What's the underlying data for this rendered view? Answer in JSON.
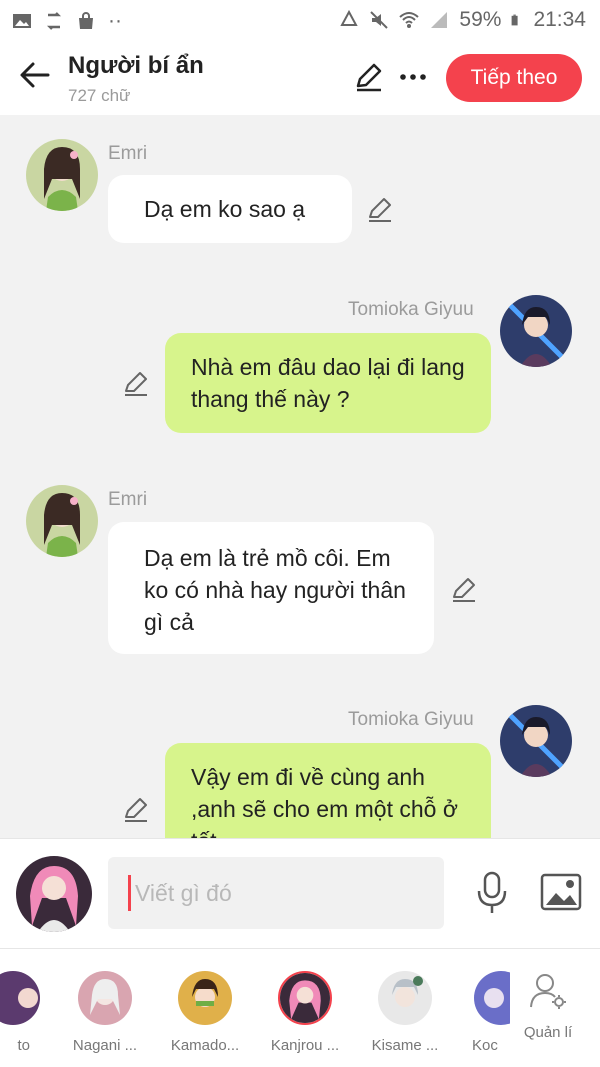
{
  "statusbar": {
    "battery": "59%",
    "time": "21:34"
  },
  "header": {
    "title": "Người bí ẩn",
    "subtitle": "727 chữ",
    "next_label": "Tiếp theo"
  },
  "messages": [
    {
      "sender": "Emri",
      "text": "Dạ em ko sao ạ",
      "side": "left"
    },
    {
      "sender": "Tomioka Giyuu",
      "text": "Nhà em đâu dao lại đi lang thang thế này ?",
      "side": "right"
    },
    {
      "sender": "Emri",
      "text": "Dạ em là trẻ mồ côi. Em ko có nhà hay người thân gì cả",
      "side": "left"
    },
    {
      "sender": "Tomioka Giyuu",
      "text": "Vậy em đi về cùng anh ,anh sẽ cho em một chỗ ở tốt",
      "side": "right"
    }
  ],
  "composer": {
    "placeholder": "Viết gì đó"
  },
  "characters": [
    {
      "name": "to"
    },
    {
      "name": "Nagani ..."
    },
    {
      "name": "Kamado..."
    },
    {
      "name": "Kanjrou ..."
    },
    {
      "name": "Kisame ..."
    },
    {
      "name": "Koc"
    }
  ],
  "manage_label": "Quản lí",
  "colors": {
    "accent": "#f4424d",
    "right_bubble": "#d7f48c",
    "left_bubble": "#ffffff"
  }
}
